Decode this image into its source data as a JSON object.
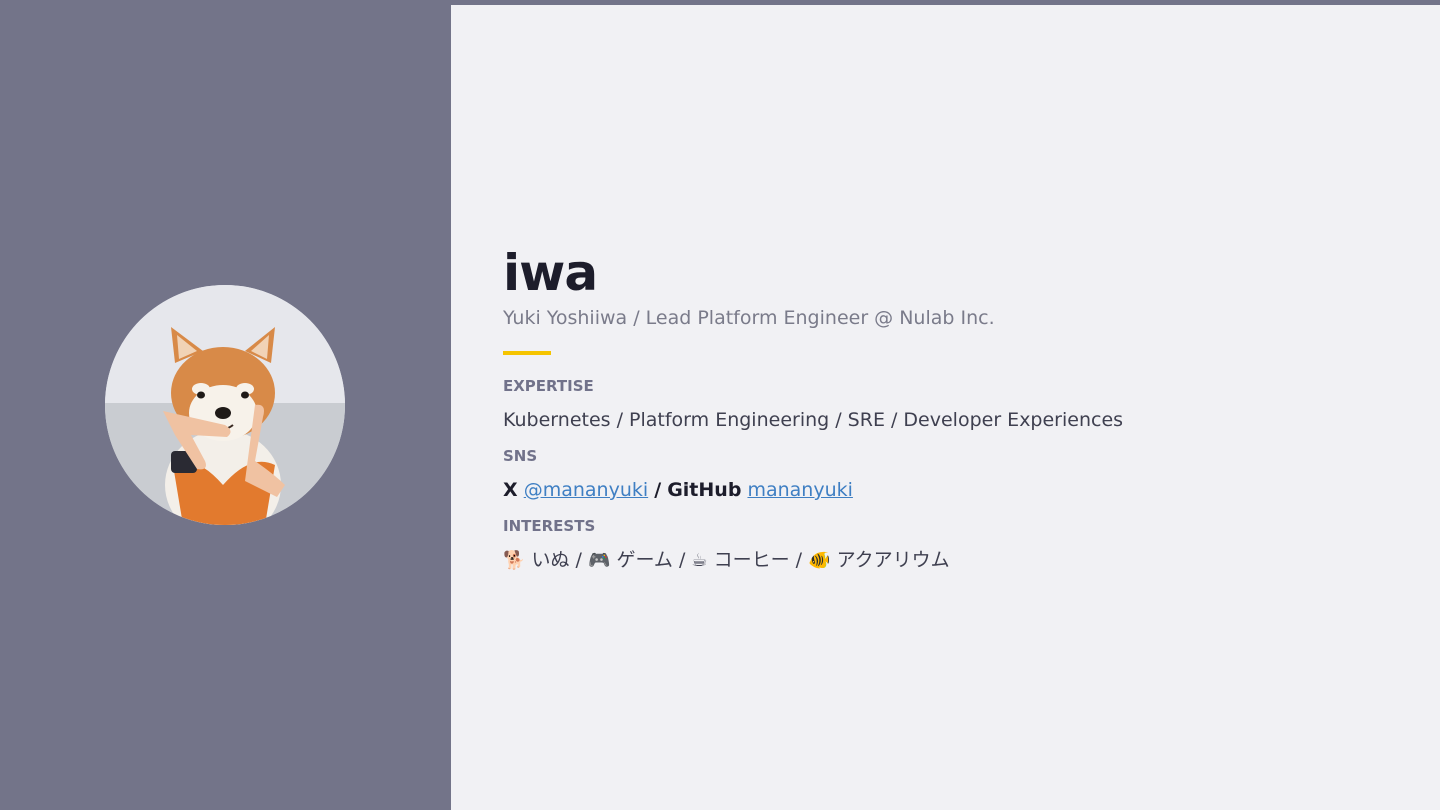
{
  "profile": {
    "name": "iwa",
    "subtitle": "Yuki Yoshiiwa / Lead Platform Engineer @ Nulab Inc."
  },
  "expertise": {
    "label": "EXPERTISE",
    "value": "Kubernetes / Platform Engineering / SRE / Developer Experiences"
  },
  "sns": {
    "label": "SNS",
    "x_label": "X",
    "x_handle": "@mananyuki",
    "separator": "/",
    "github_label": "GitHub",
    "github_handle": "mananyuki"
  },
  "interests": {
    "label": "INTERESTS",
    "items": [
      {
        "icon": "dog-icon",
        "glyph": "🐕",
        "text": "いぬ"
      },
      {
        "icon": "game-controller-icon",
        "glyph": "🎮",
        "text": "ゲーム"
      },
      {
        "icon": "coffee-icon",
        "glyph": "☕",
        "text": "コーヒー"
      },
      {
        "icon": "tropical-fish-icon",
        "glyph": "🐠",
        "text": "アクアリウム"
      }
    ],
    "separator": "/"
  },
  "colors": {
    "left_panel": "#737489",
    "right_panel": "#f1f1f4",
    "accent": "#f5c400",
    "link": "#3f7fc3"
  }
}
